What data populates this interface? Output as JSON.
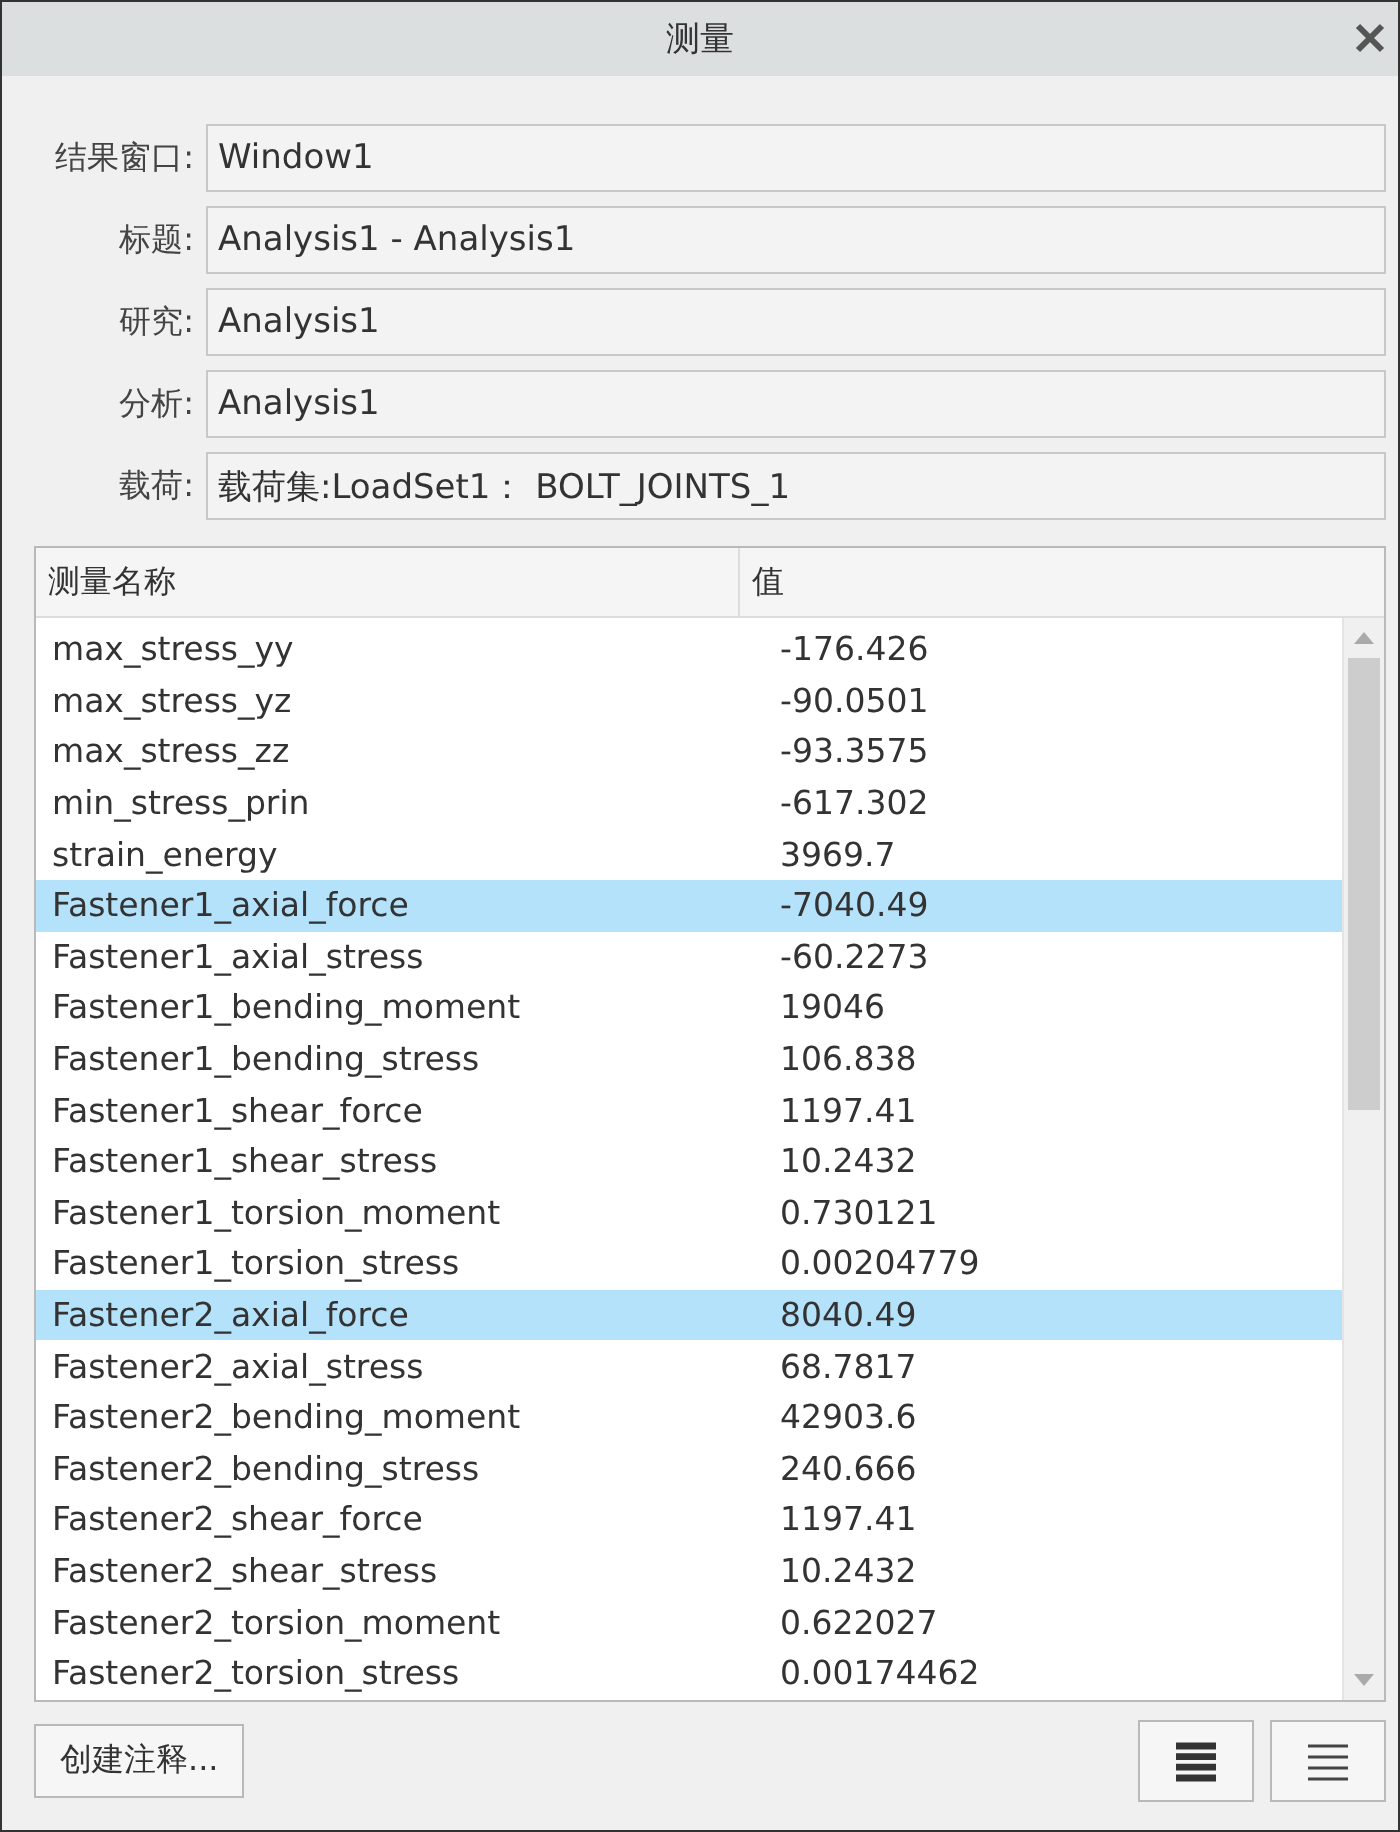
{
  "window": {
    "title": "测量"
  },
  "fields": [
    {
      "label": "结果窗口:",
      "value": "Window1"
    },
    {
      "label": "标题:",
      "value": "Analysis1 - Analysis1"
    },
    {
      "label": "研究:",
      "value": "Analysis1"
    },
    {
      "label": "分析:",
      "value": "Analysis1"
    },
    {
      "label": "载荷:",
      "value": "载荷集:LoadSet1： BOLT_JOINTS_1"
    }
  ],
  "table": {
    "columns": [
      "测量名称",
      "值"
    ],
    "rows": [
      {
        "name": "max_stress_yy",
        "value": "-176.426",
        "selected": false
      },
      {
        "name": "max_stress_yz",
        "value": "-90.0501",
        "selected": false
      },
      {
        "name": "max_stress_zz",
        "value": "-93.3575",
        "selected": false
      },
      {
        "name": "min_stress_prin",
        "value": "-617.302",
        "selected": false
      },
      {
        "name": "strain_energy",
        "value": "3969.7",
        "selected": false
      },
      {
        "name": "Fastener1_axial_force",
        "value": "-7040.49",
        "selected": true
      },
      {
        "name": "Fastener1_axial_stress",
        "value": "-60.2273",
        "selected": false
      },
      {
        "name": "Fastener1_bending_moment",
        "value": "19046",
        "selected": false
      },
      {
        "name": "Fastener1_bending_stress",
        "value": "106.838",
        "selected": false
      },
      {
        "name": "Fastener1_shear_force",
        "value": "1197.41",
        "selected": false
      },
      {
        "name": "Fastener1_shear_stress",
        "value": "10.2432",
        "selected": false
      },
      {
        "name": "Fastener1_torsion_moment",
        "value": "0.730121",
        "selected": false
      },
      {
        "name": "Fastener1_torsion_stress",
        "value": "0.00204779",
        "selected": false
      },
      {
        "name": "Fastener2_axial_force",
        "value": "8040.49",
        "selected": true
      },
      {
        "name": "Fastener2_axial_stress",
        "value": "68.7817",
        "selected": false
      },
      {
        "name": "Fastener2_bending_moment",
        "value": "42903.6",
        "selected": false
      },
      {
        "name": "Fastener2_bending_stress",
        "value": "240.666",
        "selected": false
      },
      {
        "name": "Fastener2_shear_force",
        "value": "1197.41",
        "selected": false
      },
      {
        "name": "Fastener2_shear_stress",
        "value": "10.2432",
        "selected": false
      },
      {
        "name": "Fastener2_torsion_moment",
        "value": "0.622027",
        "selected": false
      },
      {
        "name": "Fastener2_torsion_stress",
        "value": "0.00174462",
        "selected": false
      }
    ]
  },
  "buttons": {
    "create_note": "创建注释..."
  }
}
